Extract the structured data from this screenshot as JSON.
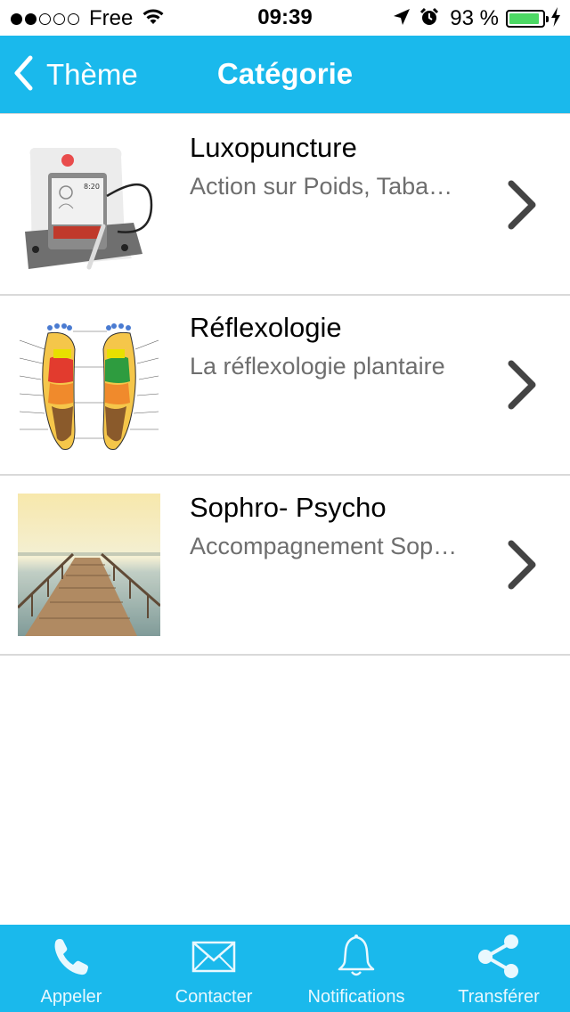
{
  "status_bar": {
    "carrier": "Free",
    "time": "09:39",
    "battery_percent": "93 %",
    "battery_level": 0.93,
    "signal_bars_filled": 2,
    "signal_bars_total": 5
  },
  "nav": {
    "back_label": "Thème",
    "title": "Catégorie"
  },
  "items": [
    {
      "title": "Luxopuncture",
      "subtitle": "Action sur Poids, Taba…",
      "image": "luxopuncture-device"
    },
    {
      "title": "Réflexologie",
      "subtitle": "La réflexologie plantaire",
      "image": "foot-reflexology-chart"
    },
    {
      "title": "Sophro- Psycho",
      "subtitle": "Accompagnement Sop…",
      "image": "pier-lake-photo"
    }
  ],
  "tabs": [
    {
      "label": "Appeler",
      "icon": "phone-icon"
    },
    {
      "label": "Contacter",
      "icon": "envelope-icon"
    },
    {
      "label": "Notifications",
      "icon": "bell-icon"
    },
    {
      "label": "Transférer",
      "icon": "share-icon"
    }
  ],
  "colors": {
    "accent": "#1ab9ec",
    "subtitle": "#6e6e6e",
    "battery": "#4cd964",
    "divider": "#d9d9d9"
  }
}
